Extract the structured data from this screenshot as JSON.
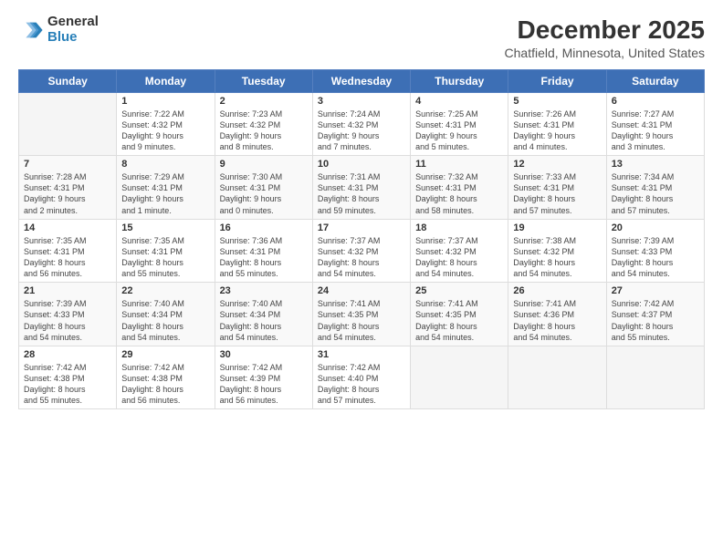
{
  "header": {
    "logo_general": "General",
    "logo_blue": "Blue",
    "title": "December 2025",
    "subtitle": "Chatfield, Minnesota, United States"
  },
  "calendar": {
    "days_of_week": [
      "Sunday",
      "Monday",
      "Tuesday",
      "Wednesday",
      "Thursday",
      "Friday",
      "Saturday"
    ],
    "weeks": [
      [
        {
          "day": "",
          "info": ""
        },
        {
          "day": "1",
          "info": "Sunrise: 7:22 AM\nSunset: 4:32 PM\nDaylight: 9 hours\nand 9 minutes."
        },
        {
          "day": "2",
          "info": "Sunrise: 7:23 AM\nSunset: 4:32 PM\nDaylight: 9 hours\nand 8 minutes."
        },
        {
          "day": "3",
          "info": "Sunrise: 7:24 AM\nSunset: 4:32 PM\nDaylight: 9 hours\nand 7 minutes."
        },
        {
          "day": "4",
          "info": "Sunrise: 7:25 AM\nSunset: 4:31 PM\nDaylight: 9 hours\nand 5 minutes."
        },
        {
          "day": "5",
          "info": "Sunrise: 7:26 AM\nSunset: 4:31 PM\nDaylight: 9 hours\nand 4 minutes."
        },
        {
          "day": "6",
          "info": "Sunrise: 7:27 AM\nSunset: 4:31 PM\nDaylight: 9 hours\nand 3 minutes."
        }
      ],
      [
        {
          "day": "7",
          "info": "Sunrise: 7:28 AM\nSunset: 4:31 PM\nDaylight: 9 hours\nand 2 minutes."
        },
        {
          "day": "8",
          "info": "Sunrise: 7:29 AM\nSunset: 4:31 PM\nDaylight: 9 hours\nand 1 minute."
        },
        {
          "day": "9",
          "info": "Sunrise: 7:30 AM\nSunset: 4:31 PM\nDaylight: 9 hours\nand 0 minutes."
        },
        {
          "day": "10",
          "info": "Sunrise: 7:31 AM\nSunset: 4:31 PM\nDaylight: 8 hours\nand 59 minutes."
        },
        {
          "day": "11",
          "info": "Sunrise: 7:32 AM\nSunset: 4:31 PM\nDaylight: 8 hours\nand 58 minutes."
        },
        {
          "day": "12",
          "info": "Sunrise: 7:33 AM\nSunset: 4:31 PM\nDaylight: 8 hours\nand 57 minutes."
        },
        {
          "day": "13",
          "info": "Sunrise: 7:34 AM\nSunset: 4:31 PM\nDaylight: 8 hours\nand 57 minutes."
        }
      ],
      [
        {
          "day": "14",
          "info": "Sunrise: 7:35 AM\nSunset: 4:31 PM\nDaylight: 8 hours\nand 56 minutes."
        },
        {
          "day": "15",
          "info": "Sunrise: 7:35 AM\nSunset: 4:31 PM\nDaylight: 8 hours\nand 55 minutes."
        },
        {
          "day": "16",
          "info": "Sunrise: 7:36 AM\nSunset: 4:31 PM\nDaylight: 8 hours\nand 55 minutes."
        },
        {
          "day": "17",
          "info": "Sunrise: 7:37 AM\nSunset: 4:32 PM\nDaylight: 8 hours\nand 54 minutes."
        },
        {
          "day": "18",
          "info": "Sunrise: 7:37 AM\nSunset: 4:32 PM\nDaylight: 8 hours\nand 54 minutes."
        },
        {
          "day": "19",
          "info": "Sunrise: 7:38 AM\nSunset: 4:32 PM\nDaylight: 8 hours\nand 54 minutes."
        },
        {
          "day": "20",
          "info": "Sunrise: 7:39 AM\nSunset: 4:33 PM\nDaylight: 8 hours\nand 54 minutes."
        }
      ],
      [
        {
          "day": "21",
          "info": "Sunrise: 7:39 AM\nSunset: 4:33 PM\nDaylight: 8 hours\nand 54 minutes."
        },
        {
          "day": "22",
          "info": "Sunrise: 7:40 AM\nSunset: 4:34 PM\nDaylight: 8 hours\nand 54 minutes."
        },
        {
          "day": "23",
          "info": "Sunrise: 7:40 AM\nSunset: 4:34 PM\nDaylight: 8 hours\nand 54 minutes."
        },
        {
          "day": "24",
          "info": "Sunrise: 7:41 AM\nSunset: 4:35 PM\nDaylight: 8 hours\nand 54 minutes."
        },
        {
          "day": "25",
          "info": "Sunrise: 7:41 AM\nSunset: 4:35 PM\nDaylight: 8 hours\nand 54 minutes."
        },
        {
          "day": "26",
          "info": "Sunrise: 7:41 AM\nSunset: 4:36 PM\nDaylight: 8 hours\nand 54 minutes."
        },
        {
          "day": "27",
          "info": "Sunrise: 7:42 AM\nSunset: 4:37 PM\nDaylight: 8 hours\nand 55 minutes."
        }
      ],
      [
        {
          "day": "28",
          "info": "Sunrise: 7:42 AM\nSunset: 4:38 PM\nDaylight: 8 hours\nand 55 minutes."
        },
        {
          "day": "29",
          "info": "Sunrise: 7:42 AM\nSunset: 4:38 PM\nDaylight: 8 hours\nand 56 minutes."
        },
        {
          "day": "30",
          "info": "Sunrise: 7:42 AM\nSunset: 4:39 PM\nDaylight: 8 hours\nand 56 minutes."
        },
        {
          "day": "31",
          "info": "Sunrise: 7:42 AM\nSunset: 4:40 PM\nDaylight: 8 hours\nand 57 minutes."
        },
        {
          "day": "",
          "info": ""
        },
        {
          "day": "",
          "info": ""
        },
        {
          "day": "",
          "info": ""
        }
      ]
    ]
  }
}
